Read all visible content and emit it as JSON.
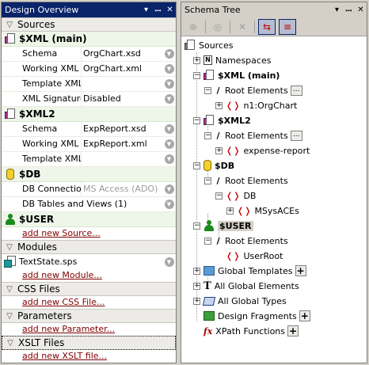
{
  "left": {
    "title": "Design Overview",
    "title_buttons": [
      "▾",
      "ꟷ",
      "✕"
    ],
    "sections": {
      "sources": "Sources",
      "modules": "Modules",
      "css": "CSS Files",
      "parameters": "Parameters",
      "xslt": "XSLT Files"
    },
    "xml_main": {
      "name": "$XML (main)",
      "rows": [
        {
          "label": "Schema",
          "value": "OrgChart.xsd"
        },
        {
          "label": "Working XML",
          "value": "OrgChart.xml"
        },
        {
          "label": "Template XML",
          "value": ""
        },
        {
          "label": "XML Signature",
          "value": "Disabled"
        }
      ]
    },
    "xml2": {
      "name": "$XML2",
      "rows": [
        {
          "label": "Schema",
          "value": "ExpReport.xsd"
        },
        {
          "label": "Working XML",
          "value": "ExpReport.xml"
        },
        {
          "label": "Template XML",
          "value": ""
        }
      ]
    },
    "db": {
      "name": "$DB",
      "rows": [
        {
          "label": "DB Connection",
          "value": "MS Access (ADO)"
        },
        {
          "label": "DB Tables and Views (1)",
          "value": ""
        }
      ]
    },
    "user": {
      "name": "$USER"
    },
    "links": {
      "add_source": "add new Source...",
      "add_module": "add new Module...",
      "add_css": "add new CSS File...",
      "add_param": "add new Parameter...",
      "add_xslt": "add new XSLT file..."
    },
    "modules": [
      {
        "name": "TextState.sps"
      }
    ]
  },
  "right": {
    "title": "Schema Tree",
    "title_buttons": [
      "▾",
      "ꟷ",
      "✕"
    ],
    "tree": {
      "sources": "Sources",
      "namespaces": "Namespaces",
      "xml_main": "$XML (main)",
      "root_elements": "Root Elements",
      "orgchart": "n1:OrgChart",
      "xml2": "$XML2",
      "expense": "expense-report",
      "db": "$DB",
      "db_node": "DB",
      "msysaces": "MSysACEs",
      "user": "$USER",
      "userroot": "UserRoot",
      "global_templates": "Global Templates",
      "all_global_elements": "All Global Elements",
      "all_global_types": "All Global Types",
      "design_fragments": "Design Fragments",
      "xpath_functions": "XPath Functions"
    }
  }
}
